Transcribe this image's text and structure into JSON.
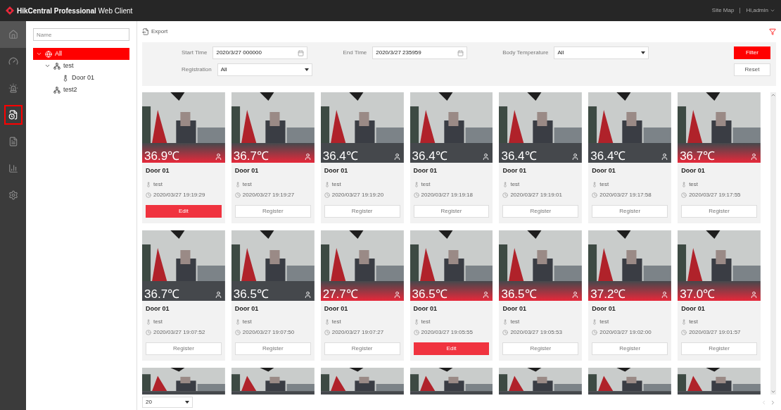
{
  "window": {
    "title_bold": "HikCentral Professional",
    "title_rest": "Web Client",
    "links": [
      "Site Map",
      "Hi,admin"
    ]
  },
  "rail": [
    {
      "selected": false
    },
    {
      "selected": false
    },
    {
      "selected": false
    },
    {
      "selected": true
    },
    {
      "selected": false
    },
    {
      "selected": false
    },
    {
      "selected": false
    }
  ],
  "tree": {
    "search_placeholder": "Name",
    "nodes": [
      {
        "label": "All",
        "kind": "root",
        "selected": true,
        "expanded": true,
        "children": [
          {
            "label": "test",
            "kind": "area",
            "selected": false,
            "expanded": true,
            "children": [
              {
                "label": "Door 01",
                "kind": "door",
                "selected": false,
                "expanded": false
              }
            ]
          },
          {
            "label": "test2",
            "kind": "area",
            "selected": false,
            "expanded": false
          }
        ]
      }
    ]
  },
  "toolbar": {
    "export": "Export"
  },
  "filters": {
    "start_label": "Start Time",
    "start_value": "2020/3/27 000000",
    "end_label": "End Time",
    "end_value": "2020/3/27 235959",
    "temp_label": "Body Temperature",
    "temp_value": "All",
    "reg_label": "Registration",
    "reg_value": "All",
    "filter_button": "Filter",
    "reset_button": "Reset"
  },
  "cards": [
    {
      "kind": "full",
      "temperature": "36.9℃",
      "alarm": true,
      "door": "Door 01",
      "group": "test",
      "time": "2020/03/27 19:19:29",
      "action": {
        "label": "Edit",
        "kind": "primary"
      }
    },
    {
      "kind": "full",
      "temperature": "36.7℃",
      "alarm": true,
      "door": "Door 01",
      "group": "test",
      "time": "2020/03/27 19:19:27",
      "action": {
        "label": "Register",
        "kind": "secondary"
      }
    },
    {
      "kind": "full",
      "temperature": "36.4℃",
      "alarm": false,
      "door": "Door 01",
      "group": "test",
      "time": "2020/03/27 19:19:20",
      "action": {
        "label": "Register",
        "kind": "secondary"
      }
    },
    {
      "kind": "full",
      "temperature": "36.4℃",
      "alarm": false,
      "door": "Door 01",
      "group": "test",
      "time": "2020/03/27 19:19:18",
      "action": {
        "label": "Register",
        "kind": "secondary"
      }
    },
    {
      "kind": "full",
      "temperature": "36.4℃",
      "alarm": false,
      "door": "Door 01",
      "group": "test",
      "time": "2020/03/27 19:19:01",
      "action": {
        "label": "Register",
        "kind": "secondary"
      }
    },
    {
      "kind": "full",
      "temperature": "36.4℃",
      "alarm": false,
      "door": "Door 01",
      "group": "test",
      "time": "2020/03/27 19:17:58",
      "action": {
        "label": "Register",
        "kind": "secondary"
      }
    },
    {
      "kind": "full",
      "temperature": "36.7℃",
      "alarm": true,
      "door": "Door 01",
      "group": "test",
      "time": "2020/03/27 19:17:55",
      "action": {
        "label": "Register",
        "kind": "secondary"
      }
    },
    {
      "kind": "full",
      "temperature": "36.7℃",
      "alarm": false,
      "door": "Door 01",
      "group": "test",
      "time": "2020/03/27 19:07:52",
      "action": {
        "label": "Register",
        "kind": "secondary"
      }
    },
    {
      "kind": "full",
      "temperature": "36.5℃",
      "alarm": false,
      "door": "Door 01",
      "group": "test",
      "time": "2020/03/27 19:07:50",
      "action": {
        "label": "Register",
        "kind": "secondary"
      }
    },
    {
      "kind": "full",
      "temperature": "27.7℃",
      "alarm": true,
      "door": "Door 01",
      "group": "test",
      "time": "2020/03/27 19:07:27",
      "action": {
        "label": "Register",
        "kind": "secondary"
      }
    },
    {
      "kind": "full",
      "temperature": "36.5℃",
      "alarm": true,
      "door": "Door 01",
      "group": "test",
      "time": "2020/03/27 19:05:55",
      "action": {
        "label": "Edit",
        "kind": "primary"
      }
    },
    {
      "kind": "full",
      "temperature": "36.5℃",
      "alarm": true,
      "door": "Door 01",
      "group": "test",
      "time": "2020/03/27 19:05:53",
      "action": {
        "label": "Register",
        "kind": "secondary"
      }
    },
    {
      "kind": "full",
      "temperature": "37.2℃",
      "alarm": true,
      "door": "Door 01",
      "group": "test",
      "time": "2020/03/27 19:02:00",
      "action": {
        "label": "Register",
        "kind": "secondary"
      }
    },
    {
      "kind": "full",
      "temperature": "37.0℃",
      "alarm": true,
      "door": "Door 01",
      "group": "test",
      "time": "2020/03/27 19:01:57",
      "action": {
        "label": "Register",
        "kind": "secondary"
      }
    },
    {
      "kind": "partial"
    },
    {
      "kind": "partial"
    },
    {
      "kind": "partial"
    },
    {
      "kind": "partial"
    },
    {
      "kind": "partial"
    },
    {
      "kind": "partial"
    },
    {
      "kind": "partial"
    }
  ],
  "pager": {
    "page_size": "20"
  }
}
